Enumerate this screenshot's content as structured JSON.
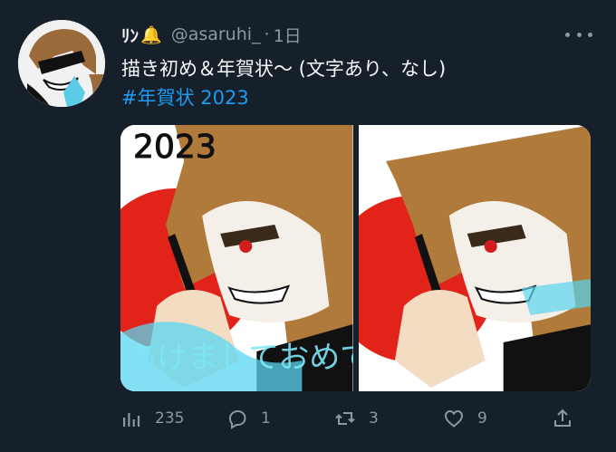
{
  "tweet": {
    "display_name": "ﾘﾝ",
    "bell_emoji": "🔔",
    "handle": "@asaruhi_",
    "separator": "·",
    "time": "1日",
    "text": "描き初め＆年賀状～ (文字あり、なし)",
    "hashtag": "#年賀状 2023",
    "more_icon": "more-horizontal-icon"
  },
  "media": {
    "left_overlay_text": "2023",
    "left_handwriting": "あけましておめでとう",
    "count": 2
  },
  "actions": {
    "views": "235",
    "replies": "1",
    "retweets": "3",
    "likes": "9"
  },
  "colors": {
    "background": "#15202b",
    "text": "#f7f9f9",
    "secondary": "#8b98a5",
    "link": "#1d9bf0",
    "sun_red": "#e2231a",
    "hair": "#b07a3a",
    "cyan_glow": "#59d6f0"
  }
}
